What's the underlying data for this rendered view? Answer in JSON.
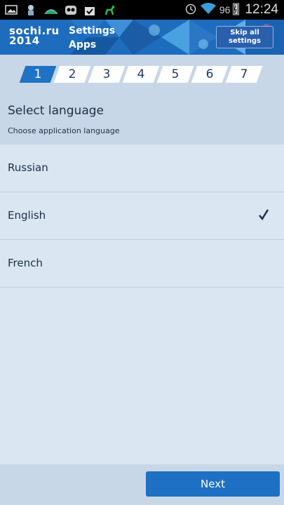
{
  "status_bar": {
    "icons": [
      "image-icon",
      "hat-figure-icon",
      "landscape-icon",
      "android-icon",
      "bag-check-icon",
      "deer-icon"
    ],
    "battery_percent": "96",
    "time": "12:24"
  },
  "header": {
    "logo_line1": "sochi.ru",
    "logo_line2": "2014",
    "title_line1": "Settings",
    "title_line2": "Apps",
    "skip_line1": "Skip all",
    "skip_line2": "settings"
  },
  "steps": {
    "items": [
      "1",
      "2",
      "3",
      "4",
      "5",
      "6",
      "7"
    ],
    "active": "1"
  },
  "section": {
    "title": "Select language",
    "subtitle": "Choose application language"
  },
  "languages": [
    {
      "label": "Russian",
      "selected": false
    },
    {
      "label": "English",
      "selected": true
    },
    {
      "label": "French",
      "selected": false
    }
  ],
  "footer": {
    "next_label": "Next"
  },
  "colors": {
    "accent": "#1d70c3",
    "background": "#dae6f1",
    "panel": "#c7d7e7"
  }
}
